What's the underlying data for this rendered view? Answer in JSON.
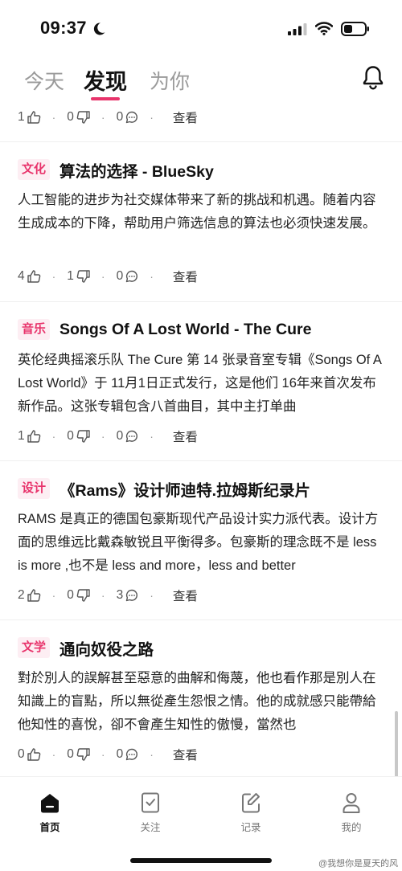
{
  "status": {
    "time": "09:37"
  },
  "tabs": [
    {
      "label": "今天"
    },
    {
      "label": "发现"
    },
    {
      "label": "为你"
    }
  ],
  "accent_color": "#e8336b",
  "partial_card": {
    "likes": "1",
    "dislikes": "0",
    "comments": "0",
    "view": "查看"
  },
  "cards": [
    {
      "tag": "文化",
      "title": "算法的选择 - BlueSky",
      "body": "人工智能的进步为社交媒体带来了新的挑战和机遇。随着内容生成成本的下降，帮助用户筛选信息的算法也必须快速发展。",
      "likes": "4",
      "dislikes": "1",
      "comments": "0",
      "view": "查看"
    },
    {
      "tag": "音乐",
      "title": "Songs Of A Lost World - The Cure",
      "body": "英伦经典摇滚乐队 The Cure 第 14 张录音室专辑《Songs Of A Lost World》于 11月1日正式发行，这是他们 16年来首次发布新作品。这张专辑包含八首曲目，其中主打单曲",
      "likes": "1",
      "dislikes": "0",
      "comments": "0",
      "view": "查看"
    },
    {
      "tag": "设计",
      "title": "《Rams》设计师迪特.拉姆斯纪录片",
      "body": "RAMS 是真正的德国包豪斯现代产品设计实力派代表。设计方面的思维远比戴森敏锐且平衡得多。包豪斯的理念既不是 less is more ,也不是 less and more，less and better",
      "likes": "2",
      "dislikes": "0",
      "comments": "3",
      "view": "查看"
    },
    {
      "tag": "文学",
      "title": "通向奴役之路",
      "body": "對於別人的誤解甚至惡意的曲解和侮蔑，他也看作那是別人在知識上的盲點，所以無從產生怨恨之情。他的成就感只能帶給他知性的喜悅，卻不會產生知性的傲慢，當然也",
      "likes": "0",
      "dislikes": "0",
      "comments": "0",
      "view": "查看"
    }
  ],
  "bottom_nav": [
    {
      "label": "首页",
      "icon": "home-icon"
    },
    {
      "label": "关注",
      "icon": "bookmark-check-icon"
    },
    {
      "label": "记录",
      "icon": "edit-note-icon"
    },
    {
      "label": "我的",
      "icon": "person-icon"
    }
  ],
  "watermark": "@我想你是夏天的风"
}
